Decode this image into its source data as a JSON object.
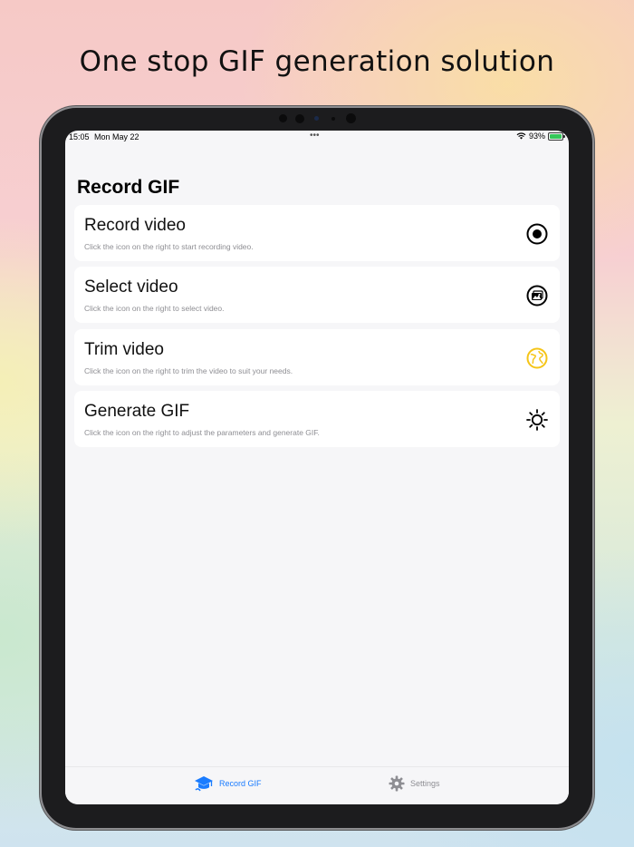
{
  "promo": {
    "headline": "One stop GIF generation solution"
  },
  "status_bar": {
    "time": "15:05",
    "date": "Mon May 22",
    "battery": "93%"
  },
  "page": {
    "title": "Record GIF"
  },
  "cards": [
    {
      "title": "Record video",
      "subtitle": "Click the icon on the right to start recording video.",
      "icon": "record-icon"
    },
    {
      "title": "Select video",
      "subtitle": "Click the icon on the right to select video.",
      "icon": "photo-library-icon"
    },
    {
      "title": "Trim video",
      "subtitle": "Click the icon on the right to trim the video to suit your needs.",
      "icon": "globe-icon"
    },
    {
      "title": "Generate GIF",
      "subtitle": "Click the icon on the right to adjust the parameters and generate GIF.",
      "icon": "sun-icon"
    }
  ],
  "tabbar": {
    "tabs": [
      {
        "label": "Record GIF",
        "icon": "graduation-cap-icon",
        "active": true
      },
      {
        "label": "Settings",
        "icon": "gear-icon",
        "active": false
      }
    ]
  },
  "colors": {
    "accent": "#1a7cff",
    "globe": "#f5c518",
    "battery": "#34c759"
  }
}
